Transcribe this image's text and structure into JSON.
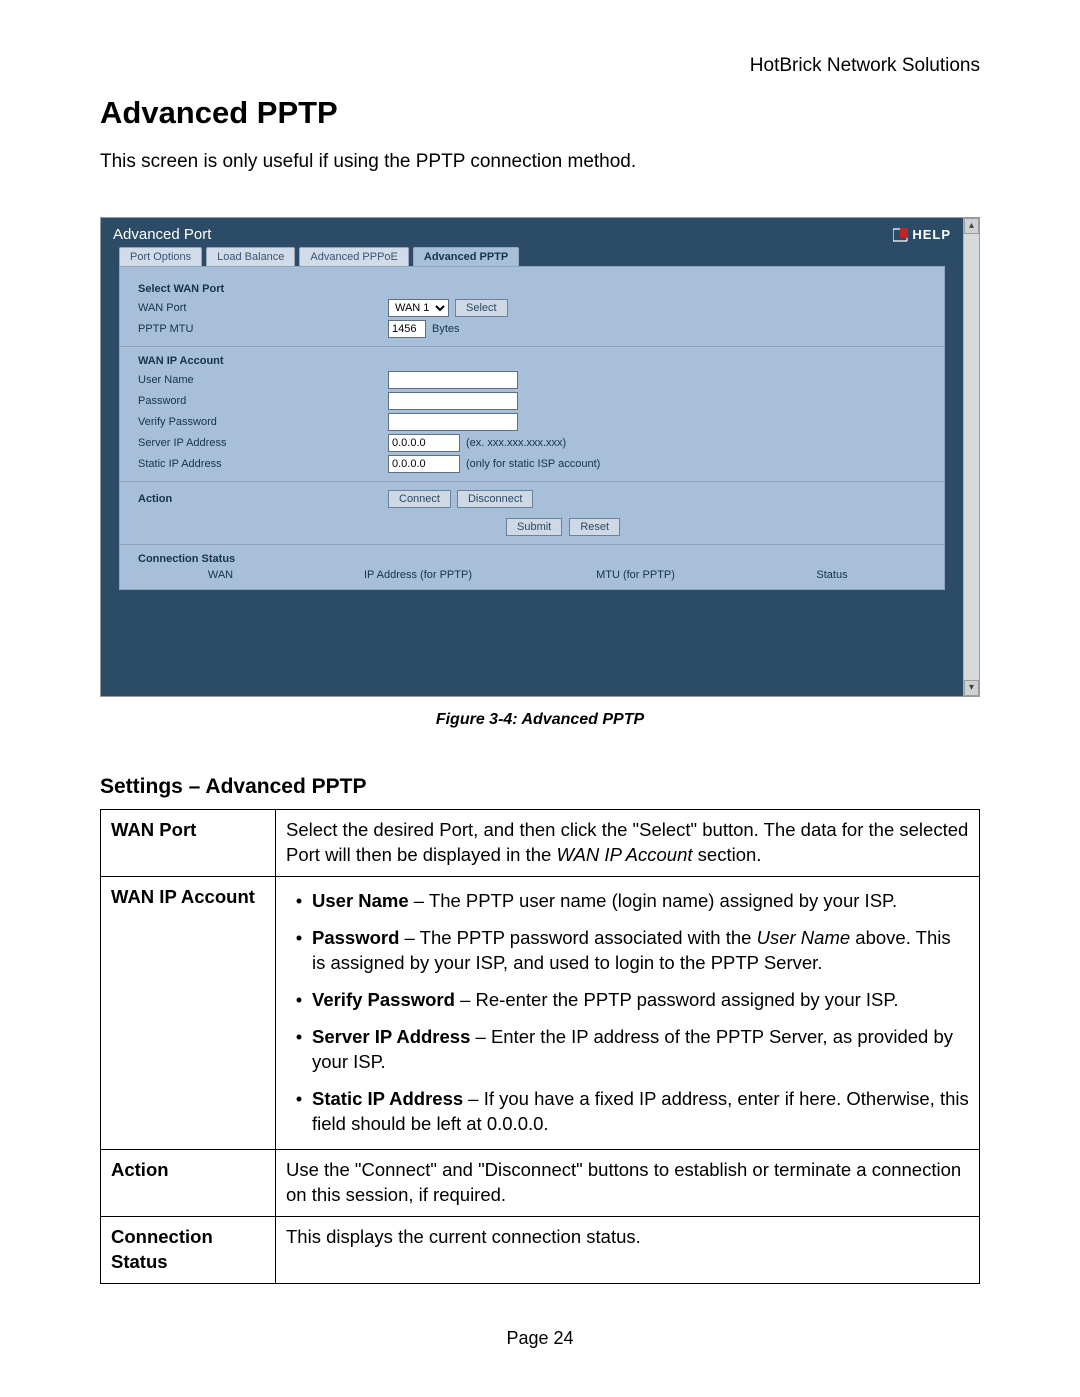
{
  "header_right": "HotBrick Network Solutions",
  "title": "Advanced PPTP",
  "intro": "This screen is only useful if using the PPTP connection method.",
  "shot": {
    "window_title": "Advanced Port",
    "help_label": "HELP",
    "tabs": [
      "Port Options",
      "Load Balance",
      "Advanced PPPoE",
      "Advanced PPTP"
    ],
    "active_tab": 3,
    "section1_title": "Select WAN Port",
    "wan_port_label": "WAN Port",
    "wan_port_value": "WAN 1",
    "select_btn": "Select",
    "pptp_mtu_label": "PPTP MTU",
    "pptp_mtu_value": "1456",
    "pptp_mtu_suffix": "Bytes",
    "section2_title": "WAN IP Account",
    "user_name_label": "User Name",
    "password_label": "Password",
    "verify_password_label": "Verify Password",
    "server_ip_label": "Server IP Address",
    "server_ip_value": "0.0.0.0",
    "server_ip_hint": "(ex. xxx.xxx.xxx.xxx)",
    "static_ip_label": "Static IP Address",
    "static_ip_value": "0.0.0.0",
    "static_ip_hint": "(only for static ISP account)",
    "action_label": "Action",
    "connect_btn": "Connect",
    "disconnect_btn": "Disconnect",
    "submit_btn": "Submit",
    "reset_btn": "Reset",
    "conn_status_title": "Connection Status",
    "col_wan": "WAN",
    "col_ip": "IP Address (for PPTP)",
    "col_mtu": "MTU (for PPTP)",
    "col_status": "Status"
  },
  "fig_caption": "Figure 3-4: Advanced PPTP",
  "settings_heading": "Settings – Advanced PPTP",
  "table": {
    "wan_port": {
      "k": "WAN Port",
      "v_pre": "Select the desired Port, and then click the \"Select\" button. The data for the selected Port will then be displayed in the ",
      "v_ital": "WAN IP Account",
      "v_post": " section."
    },
    "wan_ip": {
      "k": "WAN IP Account",
      "b1_bold": "User Name",
      "b1_rest": " – The PPTP user name (login name) assigned by your ISP.",
      "b2_bold": "Password",
      "b2_mid1": " – The PPTP password associated with the ",
      "b2_ital": "User Name",
      "b2_mid2": " above. This is assigned by your ISP, and used to login to the PPTP Server.",
      "b3_bold": "Verify Password",
      "b3_rest": " – Re-enter the PPTP password assigned by your ISP.",
      "b4_bold": "Server IP Address",
      "b4_rest": " – Enter the IP address of the PPTP Server, as provided by your ISP.",
      "b5_bold": "Static IP Address",
      "b5_rest": " – If you have a fixed IP address, enter if here. Otherwise, this field should be left at 0.0.0.0."
    },
    "action": {
      "k": "Action",
      "v": "Use the \"Connect\" and \"Disconnect\" buttons to establish or terminate a connection on this session, if required."
    },
    "conn": {
      "k": "Connection Status",
      "v": "This displays the current connection status."
    }
  },
  "page_footer": "Page 24"
}
